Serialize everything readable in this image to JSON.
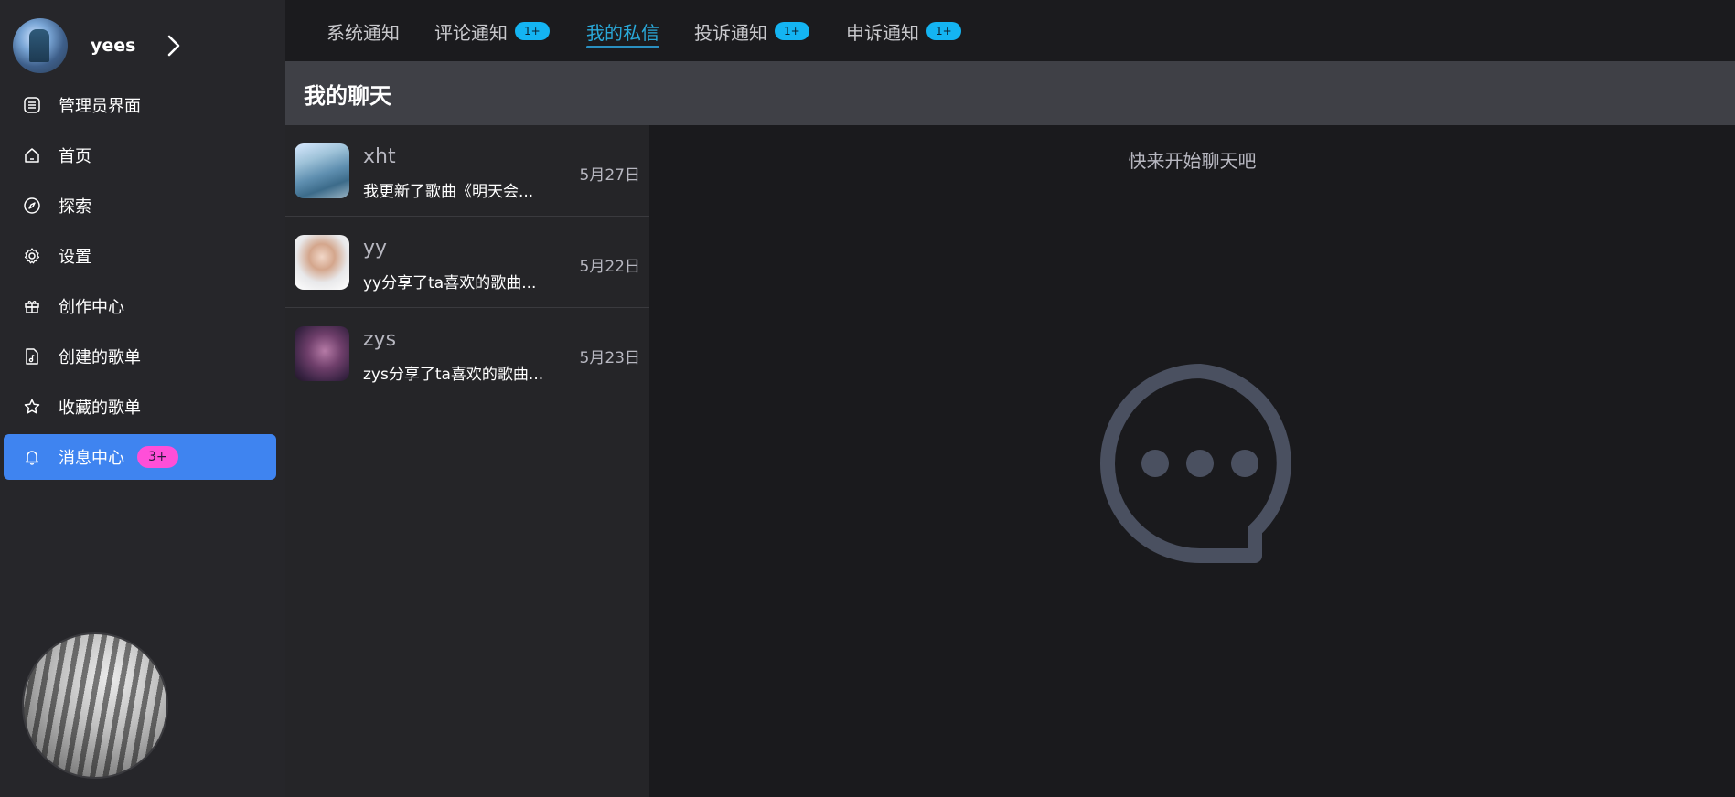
{
  "user": {
    "name": "yees"
  },
  "sidebar": {
    "items": [
      {
        "label": "管理员界面",
        "icon": "admin-panel-icon"
      },
      {
        "label": "首页",
        "icon": "home-icon"
      },
      {
        "label": "探索",
        "icon": "compass-icon"
      },
      {
        "label": "设置",
        "icon": "gear-icon"
      },
      {
        "label": "创作中心",
        "icon": "gift-icon"
      },
      {
        "label": "创建的歌单",
        "icon": "music-file-icon"
      },
      {
        "label": "收藏的歌单",
        "icon": "star-icon"
      },
      {
        "label": "消息中心",
        "icon": "bell-icon",
        "badge": "3+",
        "active": true
      }
    ]
  },
  "tabs": [
    {
      "label": "系统通知",
      "badge": ""
    },
    {
      "label": "评论通知",
      "badge": "1+"
    },
    {
      "label": "我的私信",
      "badge": "",
      "active": true
    },
    {
      "label": "投诉通知",
      "badge": "1+"
    },
    {
      "label": "申诉通知",
      "badge": "1+"
    }
  ],
  "chat": {
    "title": "我的聊天",
    "hint": "快来开始聊天吧",
    "conversations": [
      {
        "name": "xht",
        "preview": "我更新了歌曲《明天会...",
        "date": "5月27日"
      },
      {
        "name": "yy",
        "preview": "yy分享了ta喜欢的歌曲...",
        "date": "5月22日"
      },
      {
        "name": "zys",
        "preview": "zys分享了ta喜欢的歌曲...",
        "date": "5月23日"
      }
    ]
  },
  "colors": {
    "sidebar_bg": "#26262a",
    "active_item": "#3f84f0",
    "tab_active": "#2aa8d8",
    "badge_blue": "#14b4f2",
    "badge_pink": "#ff4fd8"
  }
}
